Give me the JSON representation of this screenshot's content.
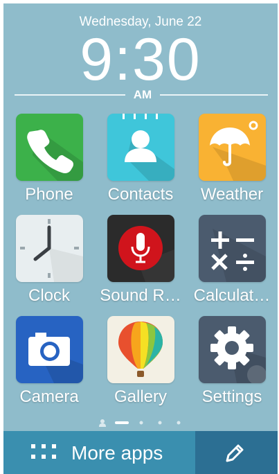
{
  "lockscreen": {
    "date": "Wednesday, June 22",
    "time": "9:30",
    "ampm": "AM"
  },
  "apps": [
    {
      "label": "Phone",
      "icon": "phone-icon",
      "color": "#3cb14a"
    },
    {
      "label": "Contacts",
      "icon": "contacts-icon",
      "color": "#3fc6da"
    },
    {
      "label": "Weather",
      "icon": "umbrella-icon",
      "color": "#f9b233"
    },
    {
      "label": "Clock",
      "icon": "clock-icon",
      "color": "#e8eef0"
    },
    {
      "label": "Sound R…",
      "icon": "microphone-icon",
      "color": "#2b2b2b"
    },
    {
      "label": "Calculat…",
      "icon": "calculator-icon",
      "color": "#4b5b6e"
    },
    {
      "label": "Camera",
      "icon": "camera-icon",
      "color": "#2763c2"
    },
    {
      "label": "Gallery",
      "icon": "balloon-icon",
      "color": "#f3f0e4"
    },
    {
      "label": "Settings",
      "icon": "gear-icon",
      "color": "#4b5b6e"
    }
  ],
  "page_indicator": {
    "pages": 5,
    "current": 1
  },
  "dock": {
    "more_apps_label": "More apps",
    "more_apps_color": "#3a8faf",
    "edit_color": "#2c6f93"
  }
}
